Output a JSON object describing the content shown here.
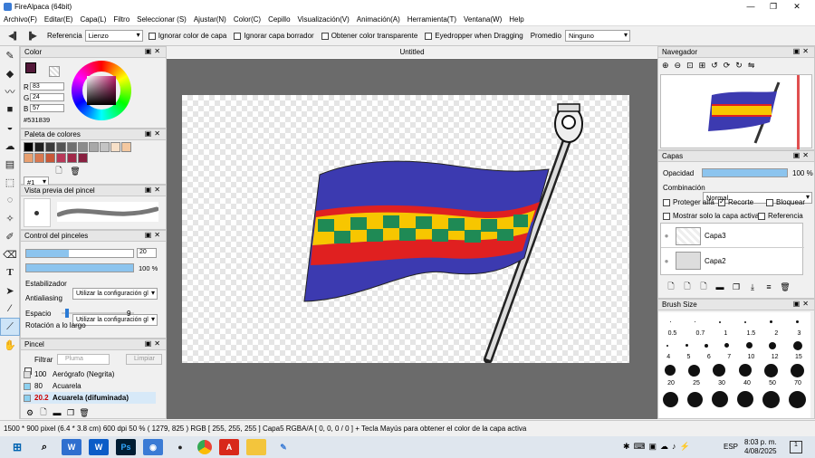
{
  "window": {
    "title": "FireAlpaca (64bit)",
    "minimize": "—",
    "restore": "❐",
    "close": "✕"
  },
  "menu": [
    "Archivo(F)",
    "Editar(E)",
    "Capa(L)",
    "Filtro",
    "Seleccionar (S)",
    "Ajustar(N)",
    "Color(C)",
    "Cepillo",
    "Visualización(V)",
    "Animación(A)",
    "Herramienta(T)",
    "Ventana(W)",
    "Help"
  ],
  "toolbar": {
    "referencia_label": "Referencia",
    "referencia_value": "Lienzo",
    "ignorar_color": "Ignorar color de capa",
    "ignorar_borrador": "Ignorar capa borrador",
    "obtener_transparente": "Obtener color transparente",
    "eyedropper": "Eyedropper when Dragging",
    "promedio_label": "Promedio",
    "promedio_value": "Ninguno"
  },
  "color_panel": {
    "title": "Color",
    "r_label": "R",
    "r": "83",
    "g_label": "G",
    "g": "24",
    "b_label": "B",
    "b": "57",
    "hex": "#531839",
    "current_color": "#531839"
  },
  "palette_panel": {
    "title": "Paleta de colores",
    "index": "#1",
    "colors": [
      "#000000",
      "#1f1f1f",
      "#3a3a3a",
      "#555555",
      "#707070",
      "#8c8c8c",
      "#a8a8a8",
      "#c4c4c4",
      "#f7e0c8",
      "#f4c8a0",
      "#e8a070",
      "#d87850",
      "#c85838",
      "#b83858",
      "#a02848",
      "#882040"
    ]
  },
  "brush_preview": {
    "title": "Vista previa del pincel"
  },
  "brush_control": {
    "title": "Control del pinceles",
    "size": "20",
    "opacity": "100 %",
    "estabilizador_label": "Estabilizador",
    "estabilizador_value": "Utilizar la configuración gl",
    "antialiasing_label": "Antialiasing",
    "antialiasing_value": "Utilizar la configuración gl",
    "espacio_label": "Espacio",
    "espacio_value": "9",
    "rotacion_label": "Rotación a lo largo"
  },
  "pincel_panel": {
    "title": "Pincel",
    "filtrar": "Filtrar",
    "pluma": "Pluma",
    "limpiar": "Limpiar",
    "items": [
      {
        "size": "100",
        "name": "Aerógrafo (Negrita)"
      },
      {
        "size": "80",
        "name": "Acuarela"
      },
      {
        "size": "20.2",
        "name": "Acuarela (difuminada)"
      }
    ]
  },
  "canvas": {
    "title": "Untitled"
  },
  "navigator": {
    "title": "Navegador"
  },
  "layers_panel": {
    "title": "Capas",
    "opacidad_label": "Opacidad",
    "opacidad_value": "100 %",
    "combinacion_label": "Combinación",
    "combinacion_value": "Normal",
    "proteger_alfa": "Proteger alfa",
    "recorte": "Recorte",
    "bloquear": "Bloquear",
    "mostrar_solo": "Mostrar solo la capa activa",
    "referencia": "Referencia",
    "layers": [
      "Capa3",
      "Capa2"
    ]
  },
  "brush_size_panel": {
    "title": "Brush Size",
    "rows": [
      [
        "0.5",
        "0.7",
        "1",
        "1.5",
        "2",
        "3"
      ],
      [
        "4",
        "5",
        "6",
        "7",
        "10",
        "12",
        "15"
      ],
      [
        "20",
        "25",
        "30",
        "40",
        "50",
        "70"
      ]
    ]
  },
  "status": "1500 * 900 pixel   (6.4 * 3.8 cm)   600 dpi   50 %   ( 1279, 825 )   RGB [ 255, 255, 255 ]   Capa5 RGBA/A [ 0, 0, 0 / 0 ]  + Tecla Mayús para obtener el color de la capa activa",
  "taskbar": {
    "time": "8:03 p. m.",
    "date": "4/08/2025",
    "lang": "ESP",
    "notif": "1"
  },
  "flag_colors": {
    "blue": "#3c3ab0",
    "red": "#e02020",
    "yellow": "#f7c600",
    "green": "#1f8a55"
  }
}
